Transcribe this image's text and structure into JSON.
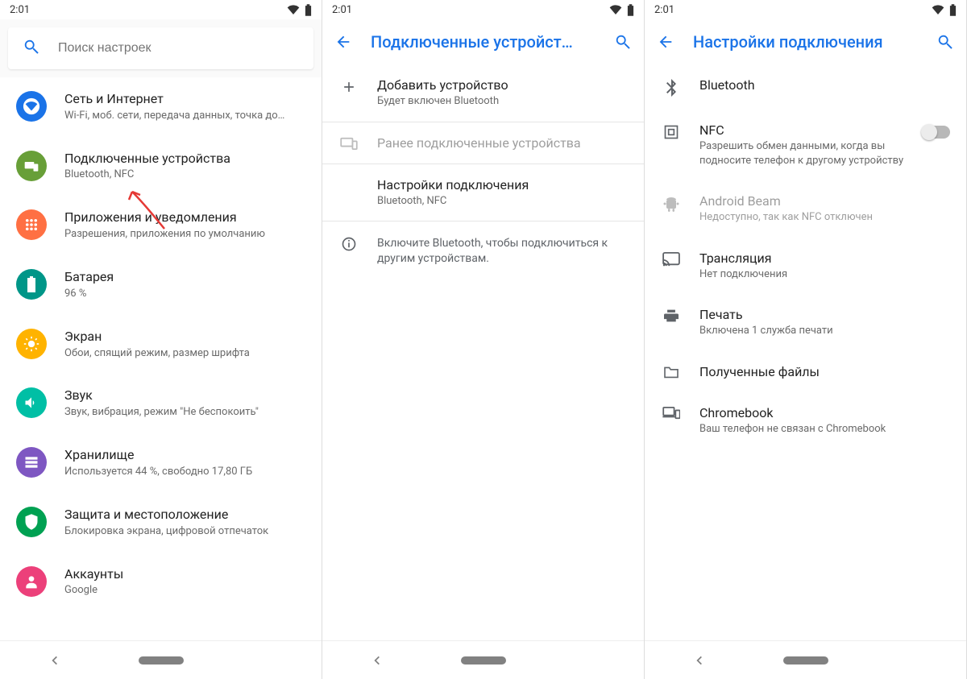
{
  "statusbar": {
    "time": "2:01"
  },
  "panel1": {
    "search_placeholder": "Поиск настроек",
    "items": [
      {
        "title": "Сеть и Интернет",
        "sub": "Wi-Fi, моб. сети, передача данных, точка до…",
        "color": "#1a73e8",
        "icon": "wifi-shape"
      },
      {
        "title": "Подключенные устройства",
        "sub": "Bluetooth, NFC",
        "color": "#689f38",
        "icon": "devices"
      },
      {
        "title": "Приложения и уведомления",
        "sub": "Разрешения, приложения по умолчанию",
        "color": "#ff7043",
        "icon": "apps-grid"
      },
      {
        "title": "Батарея",
        "sub": "96 %",
        "color": "#009688",
        "icon": "battery"
      },
      {
        "title": "Экран",
        "sub": "Обои, спящий режим, размер шрифта",
        "color": "#ffb300",
        "icon": "brightness"
      },
      {
        "title": "Звук",
        "sub": "Звук, вибрация, режим \"Не беспокоить\"",
        "color": "#00bfa5",
        "icon": "volume"
      },
      {
        "title": "Хранилище",
        "sub": "Используется 44 %, свободно 17,80 ГБ",
        "color": "#7e57c2",
        "icon": "storage"
      },
      {
        "title": "Защита и местоположение",
        "sub": "Блокировка экрана, цифровой отпечаток",
        "color": "#00a152",
        "icon": "shield"
      },
      {
        "title": "Аккаунты",
        "sub": "Google",
        "color": "#ec407a",
        "icon": "account"
      }
    ]
  },
  "panel2": {
    "title": "Подключенные устройст…",
    "add_title": "Добавить устройство",
    "add_sub": "Будет включен Bluetooth",
    "prev": "Ранее подключенные устройства",
    "prefs_title": "Настройки подключения",
    "prefs_sub": "Bluetooth, NFC",
    "info": "Включите Bluetooth, чтобы подключиться к другим устройствам."
  },
  "panel3": {
    "title": "Настройки подключения",
    "items": [
      {
        "title": "Bluetooth",
        "sub": "",
        "icon": "bluetooth"
      },
      {
        "title": "NFC",
        "sub": "Разрешить обмен данными, когда вы подносите телефон к другому устройству",
        "icon": "nfc",
        "toggle": true
      },
      {
        "title": "Android Beam",
        "sub": "Недоступно, так как NFC отключен",
        "icon": "android",
        "muted": true
      },
      {
        "title": "Трансляция",
        "sub": "Нет подключения",
        "icon": "cast"
      },
      {
        "title": "Печать",
        "sub": "Включена 1 служба печати",
        "icon": "print"
      },
      {
        "title": "Полученные файлы",
        "sub": "",
        "icon": "folder"
      },
      {
        "title": "Chromebook",
        "sub": "Ваш телефон не связан с Chromebook",
        "icon": "chromebook"
      }
    ]
  }
}
